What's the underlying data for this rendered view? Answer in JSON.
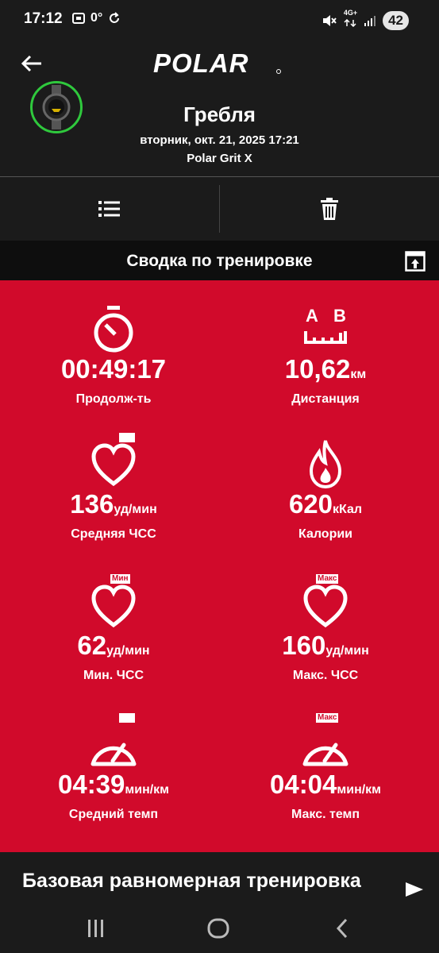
{
  "status_bar": {
    "time": "17:12",
    "temperature": "0°",
    "network": "4G+",
    "battery": "42"
  },
  "header": {
    "brand": "POLAR",
    "sport": "Гребля",
    "date": "вторник, окт. 21, 2025 17:21",
    "device": "Polar Grit X"
  },
  "summary": {
    "title": "Сводка по тренировке"
  },
  "stats": {
    "duration": {
      "value": "00:49:17",
      "unit": "",
      "label": "Продолж-ть"
    },
    "distance": {
      "value": "10,62",
      "unit": "км",
      "label": "Дистанция",
      "icon_text_a": "A",
      "icon_text_b": "B"
    },
    "avg_hr": {
      "value": "136",
      "unit": "уд/мин",
      "label": "Средняя ЧСС"
    },
    "calories": {
      "value": "620",
      "unit": "кКал",
      "label": "Калории"
    },
    "min_hr": {
      "value": "62",
      "unit": "уд/мин",
      "label": "Мин. ЧСС",
      "tag": "Мин"
    },
    "max_hr": {
      "value": "160",
      "unit": "уд/мин",
      "label": "Макс. ЧСС",
      "tag": "Макс"
    },
    "avg_pace": {
      "value": "04:39",
      "unit": "мин/км",
      "label": "Средний темп"
    },
    "max_pace": {
      "value": "04:04",
      "unit": "мин/км",
      "label": "Макс. темп",
      "tag": "Макс"
    }
  },
  "footer": {
    "training_type": "Базовая равномерная тренировка"
  },
  "colors": {
    "accent_red": "#d10a2b",
    "background": "#1b1b1b",
    "ring_green": "#2fc93d"
  }
}
